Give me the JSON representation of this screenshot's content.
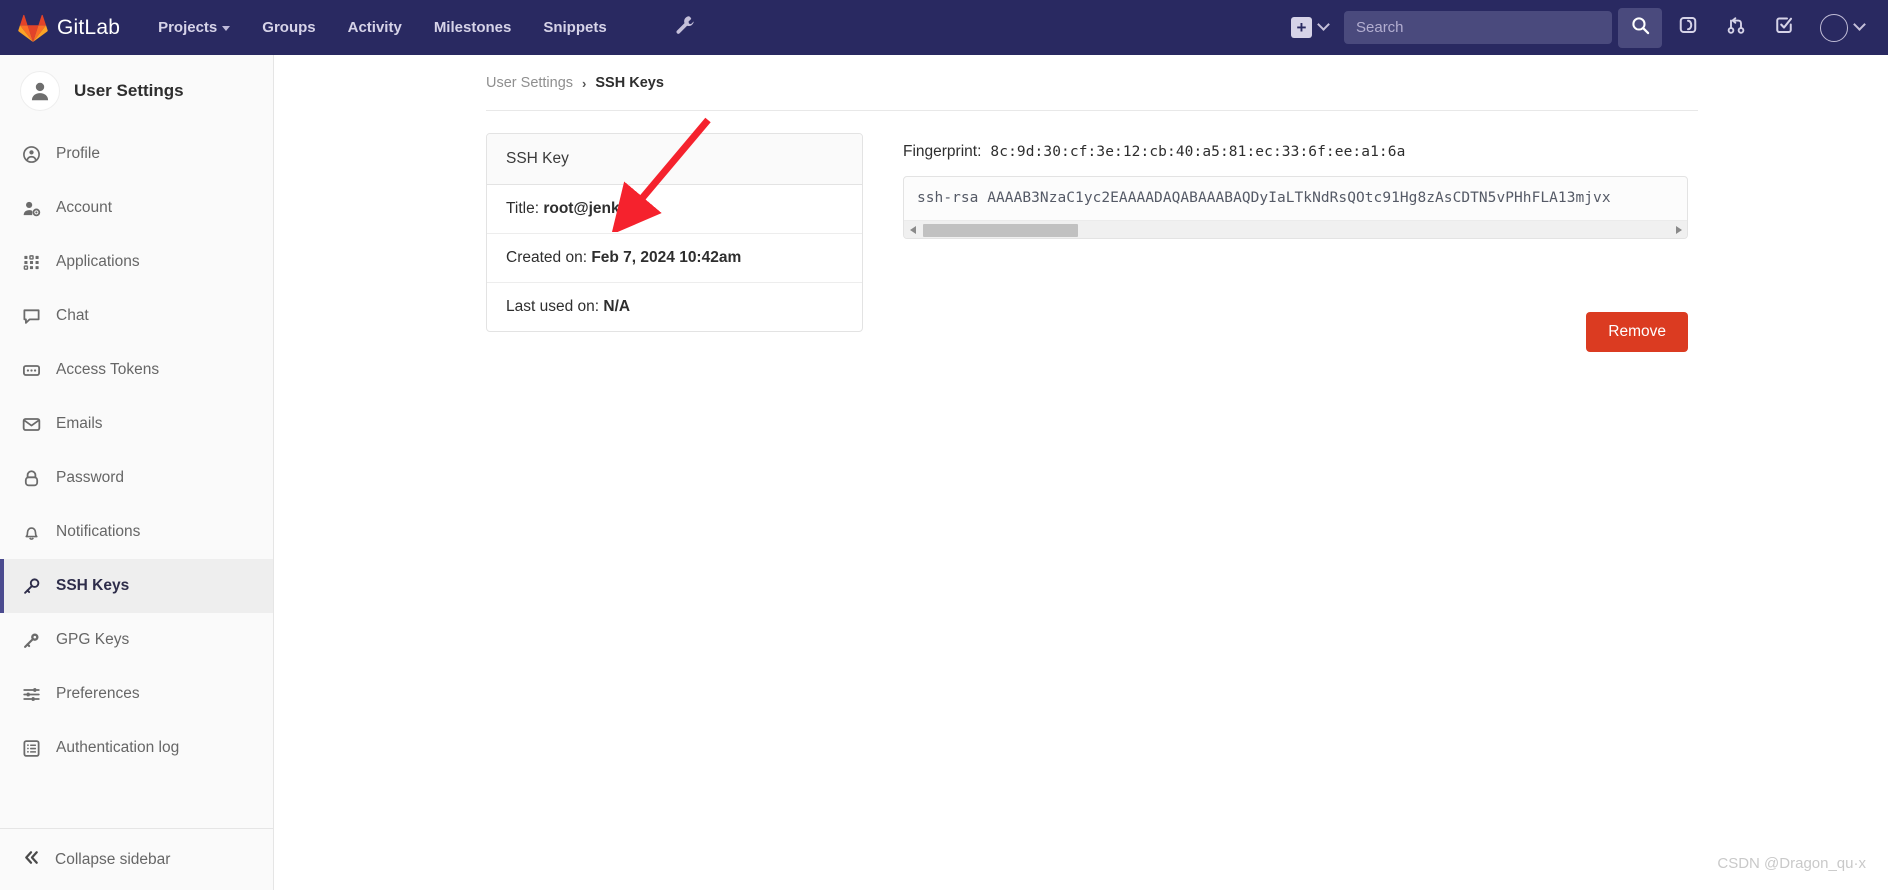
{
  "navbar": {
    "brand": "GitLab",
    "links": [
      {
        "label": "Projects",
        "has_caret": true,
        "icon": ""
      },
      {
        "label": "Groups",
        "has_caret": false,
        "icon": ""
      },
      {
        "label": "Activity",
        "has_caret": false,
        "icon": ""
      },
      {
        "label": "Milestones",
        "has_caret": false,
        "icon": ""
      },
      {
        "label": "Snippets",
        "has_caret": false,
        "icon": ""
      }
    ],
    "admin_icon": "wrench-icon",
    "new_button_label": "+",
    "search": {
      "placeholder": "Search",
      "value": ""
    },
    "icons": [
      {
        "name": "search-icon",
        "active": true
      },
      {
        "name": "issues-icon",
        "active": false
      },
      {
        "name": "merge-requests-icon",
        "active": false
      },
      {
        "name": "todos-icon",
        "active": false
      }
    ],
    "avatar": "user-avatar",
    "colors": {
      "background": "#292961",
      "search_bg": "#4a4a7d",
      "link": "#d6d3e8"
    }
  },
  "sidebar": {
    "title": "User Settings",
    "avatar_icon": "user-avatar-icon",
    "items": [
      {
        "label": "Profile",
        "icon": "profile-icon",
        "active": false
      },
      {
        "label": "Account",
        "icon": "account-icon",
        "active": false
      },
      {
        "label": "Applications",
        "icon": "applications-icon",
        "active": false
      },
      {
        "label": "Chat",
        "icon": "chat-icon",
        "active": false
      },
      {
        "label": "Access Tokens",
        "icon": "access-tokens-icon",
        "active": false
      },
      {
        "label": "Emails",
        "icon": "emails-icon",
        "active": false
      },
      {
        "label": "Password",
        "icon": "password-lock-icon",
        "active": false
      },
      {
        "label": "Notifications",
        "icon": "notifications-bell-icon",
        "active": false
      },
      {
        "label": "SSH Keys",
        "icon": "ssh-key-icon",
        "active": true
      },
      {
        "label": "GPG Keys",
        "icon": "gpg-key-icon",
        "active": false
      },
      {
        "label": "Preferences",
        "icon": "preferences-sliders-icon",
        "active": false
      },
      {
        "label": "Authentication log",
        "icon": "authentication-log-icon",
        "active": false
      }
    ],
    "collapse_label": "Collapse sidebar",
    "collapse_icon": "double-chevron-left-icon",
    "active_accent": "#4b4b8f"
  },
  "breadcrumb": {
    "parent": "User Settings",
    "separator": "›",
    "current": "SSH Keys"
  },
  "key_card": {
    "header": "SSH Key",
    "rows": [
      {
        "label": "Title:",
        "value": "root@jenkins"
      },
      {
        "label": "Created on:",
        "value": "Feb 7, 2024 10:42am"
      },
      {
        "label": "Last used on:",
        "value": "N/A"
      }
    ]
  },
  "key_detail": {
    "fingerprint_label": "Fingerprint:",
    "fingerprint_value": "8c:9d:30:cf:3e:12:cb:40:a5:81:ec:33:6f:ee:a1:6a",
    "public_key": "ssh-rsa AAAAB3NzaC1yc2EAAAADAQABAAABAQDyIaLTkNdRsQOtc91Hg8zAsCDTN5vPHhFLA13mjvx",
    "scroll_left_icon": "scroll-left-arrow-icon",
    "scroll_right_icon": "scroll-right-arrow-icon"
  },
  "actions": {
    "remove_label": "Remove",
    "remove_color": "#db3b21"
  },
  "annotation": {
    "arrow": "red-annotation-arrow",
    "color": "#f5222d"
  },
  "watermark": "CSDN @Dragon_qu·x"
}
